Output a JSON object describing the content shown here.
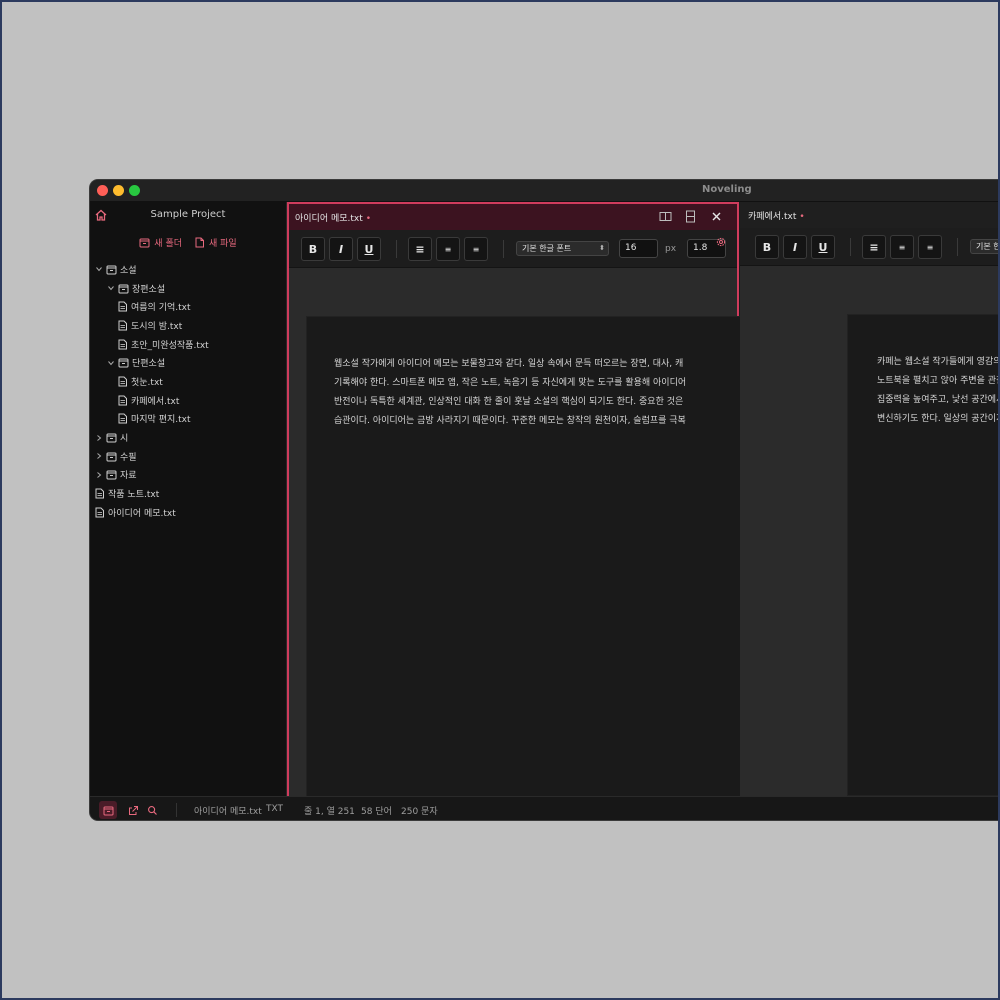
{
  "app": {
    "title": "Noveling"
  },
  "colors": {
    "accent": "#e8697e",
    "active_border": "#cf3c5d",
    "background": "#1b1b1b"
  },
  "sidebar": {
    "project_title": "Sample Project",
    "new_folder_label": "새 폴더",
    "new_file_label": "새 파일",
    "tree": [
      {
        "label": "소설",
        "type": "folder",
        "level": 0,
        "expanded": true
      },
      {
        "label": "장편소설",
        "type": "folder",
        "level": 1,
        "expanded": true
      },
      {
        "label": "여름의 기억.txt",
        "type": "file",
        "level": 2
      },
      {
        "label": "도시의 밤.txt",
        "type": "file",
        "level": 2
      },
      {
        "label": "초안_미완성작품.txt",
        "type": "file",
        "level": 2
      },
      {
        "label": "단편소설",
        "type": "folder",
        "level": 1,
        "expanded": true
      },
      {
        "label": "첫눈.txt",
        "type": "file",
        "level": 2
      },
      {
        "label": "카페에서.txt",
        "type": "file",
        "level": 2
      },
      {
        "label": "마지막 편지.txt",
        "type": "file",
        "level": 2
      },
      {
        "label": "시",
        "type": "folder",
        "level": 0,
        "expanded": false
      },
      {
        "label": "수필",
        "type": "folder",
        "level": 0,
        "expanded": false
      },
      {
        "label": "자료",
        "type": "folder",
        "level": 0,
        "expanded": false
      },
      {
        "label": "작품 노트.txt",
        "type": "file",
        "level": 0
      },
      {
        "label": "아이디어 메모.txt",
        "type": "file",
        "level": 0
      }
    ]
  },
  "editor_left": {
    "tab_title": "아이디어 메모.txt",
    "modified_dot": "•",
    "toolbar": {
      "bold": "B",
      "italic": "I",
      "underline": "U",
      "align_left": "≡",
      "align_center": "≡",
      "align_right": "≡",
      "font": "기본 한글 폰트",
      "font_size": "16",
      "unit": "px",
      "line_height": "1.8"
    },
    "lines": [
      "웹소설 작가에게 아이디어 메모는 보물창고와 같다. 일상 속에서 문득 떠오르는 장면, 대사, 캐",
      "기록해야 한다. 스마트폰 메모 앱, 작은 노트, 녹음기 등 자신에게 맞는 도구를 활용해 아이디어",
      "반전이나 독특한 세계관, 인상적인 대화 한 줄이 훗날 소설의 핵심이 되기도 한다. 중요한 것은",
      "습관이다. 아이디어는 금방 사라지기 때문이다. 꾸준한 메모는 창작의 원천이자, 슬럼프를 극복"
    ]
  },
  "editor_right": {
    "tab_title": "카페에서.txt",
    "modified_dot": "•",
    "toolbar": {
      "bold": "B",
      "italic": "I",
      "underline": "U",
      "align_left": "≡",
      "align_center": "≡",
      "align_right": "≡",
      "font": "기본 한"
    },
    "lines": [
      "카페는 웹소설 작가들에게 영감의 공간이다. 커피",
      "노트북을 펼치고 앉아 주변을 관찰하다 보면, 새로",
      "집중력을 높여주고, 낯선 공간에서의 분위기 전환",
      "변신하기도 한다. 일상의 공간이지만, 카페는 작가"
    ]
  },
  "statusbar": {
    "file_name": "아이디어 메모.txt",
    "file_type": "TXT",
    "position": "줄 1, 열 251",
    "words": "58 단어",
    "chars": "250 문자"
  }
}
